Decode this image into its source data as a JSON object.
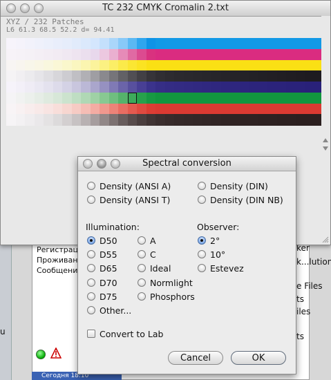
{
  "background_window": {
    "lines": [
      "Регистрац",
      "Проживань",
      "Сообщени"
    ],
    "right_lines": [
      "ker",
      "k...lution",
      "e Files",
      "ts",
      "iles",
      "ts"
    ],
    "left_fragment": "u",
    "bottom_bar": "Сегодня  18:10"
  },
  "chart_window": {
    "title": "TC 232 CMYK Cromalin 2.txt",
    "info_line": "XYZ / 232 Patches",
    "readout": "L6    61.3  68.5  52.2 d= 94.41",
    "grid": {
      "rows": [
        [
          "#f7f4fb",
          "#f5f3fb",
          "#f2f2fb",
          "#eff1fb",
          "#ecf0fb",
          "#e9eefb",
          "#e6edfb",
          "#e1ebfb",
          "#dbe9fc",
          "#d4e6fd",
          "#c4e0fc",
          "#aad6fa",
          "#88c9f8",
          "#5bb8f3",
          "#2fa5ee",
          "#0f93e6",
          "#1199e6",
          "#1299e6",
          "#1299e6",
          "#1299e6",
          "#1299e6",
          "#1299e6",
          "#1299e6",
          "#1299e6",
          "#1299e6",
          "#1299e6",
          "#1299e6",
          "#1299e6",
          "#1299e6",
          "#1299e6",
          "#1299e6",
          "#1299e6",
          "#1299e6",
          "#1299e6"
        ],
        [
          "#f7f3f8",
          "#f6f2f7",
          "#f5f1f6",
          "#f4eff5",
          "#f3edf4",
          "#f2ebf3",
          "#f0e8f2",
          "#eee4f0",
          "#ebdfee",
          "#e8d8ec",
          "#ecc8e0",
          "#eab0d0",
          "#e68bb8",
          "#e06aa3",
          "#dc4b90",
          "#d9327f",
          "#da2c80",
          "#da2c80",
          "#da2c80",
          "#da2c80",
          "#da2c80",
          "#da2c80",
          "#da2c80",
          "#da2c80",
          "#da2c80",
          "#da2c80",
          "#da2c80",
          "#da2c80",
          "#da2c80",
          "#da2c80",
          "#da2c80",
          "#da2c80",
          "#da2c80",
          "#da2c80"
        ],
        [
          "#f8f5f3",
          "#f8f5ef",
          "#f8f6ea",
          "#f9f6e5",
          "#f9f7de",
          "#faf7d6",
          "#faf7cc",
          "#faf6c0",
          "#fbf5b0",
          "#fbf39c",
          "#fbf182",
          "#fbee66",
          "#fbea4a",
          "#fbe633",
          "#fbe322",
          "#fae014",
          "#fae014",
          "#fae014",
          "#fae014",
          "#fae014",
          "#fae014",
          "#fae014",
          "#fae014",
          "#fae014",
          "#fae014",
          "#fae014",
          "#fae014",
          "#fae014",
          "#fae014",
          "#fae014",
          "#fae014",
          "#fae014",
          "#fae014",
          "#fae014"
        ],
        [
          "#f5f3f5",
          "#f1eff2",
          "#ecebee",
          "#e6e5e9",
          "#dfdee2",
          "#d7d6da",
          "#cdccd1",
          "#c0bfc4",
          "#b1b0b5",
          "#9f9ea3",
          "#8a898e",
          "#76757a",
          "#626166",
          "#514f54",
          "#424045",
          "#363439",
          "#302e33",
          "#2d2b30",
          "#2b292e",
          "#2a282d",
          "#29272c",
          "#28262b",
          "#27252a",
          "#262429",
          "#252328",
          "#242227",
          "#232126",
          "#222025",
          "#221f24",
          "#211e23",
          "#201d22",
          "#1f1c21",
          "#1e1b20",
          "#1e1b20"
        ],
        [
          "#f6f3fa",
          "#f3f0f8",
          "#efecf5",
          "#eae8f2",
          "#e4e2ee",
          "#dddbea",
          "#d4d2e5",
          "#c9c6de",
          "#bbb8d6",
          "#aaa6cc",
          "#9691c1",
          "#807ab5",
          "#6b64a9",
          "#58509e",
          "#483f95",
          "#3b338c",
          "#362e86",
          "#342c84",
          "#332b83",
          "#322a82",
          "#312981",
          "#302880",
          "#2f277f",
          "#2e267e",
          "#2e267e",
          "#2d257d",
          "#2c247c",
          "#2c247c",
          "#2b237b",
          "#2b237b",
          "#2a227a",
          "#2a227a",
          "#292179",
          "#292179"
        ],
        [
          "#f5f4f6",
          "#f1f2f1",
          "#ecf0ec",
          "#e6ede6",
          "#dfeadf",
          "#d7e7d8",
          "#cce3ce",
          "#bfdec3",
          "#b0d8b5",
          "#9fd1a5",
          "#88c892",
          "#6fbe7f",
          "#55b36b",
          "#3daa5b",
          "#27a14c",
          "#179943",
          "#12963f",
          "#12963f",
          "#12963f",
          "#12963f",
          "#12963f",
          "#12963f",
          "#12963f",
          "#12963f",
          "#12963f",
          "#12963f",
          "#12963f",
          "#12963f",
          "#12963f",
          "#12963f",
          "#12963f",
          "#12963f",
          "#12963f",
          "#12963f"
        ],
        [
          "#f8f4f6",
          "#f8f1f2",
          "#f8eded",
          "#f8e9e8",
          "#f8e4e2",
          "#f8deda",
          "#f7d6d0",
          "#f6cbc4",
          "#f5bdb5",
          "#f3aca3",
          "#f0988e",
          "#ec8378",
          "#e86d62",
          "#e45a4f",
          "#e04a40",
          "#dd3d34",
          "#db3a32",
          "#db3a32",
          "#db3a32",
          "#db3a32",
          "#db3a32",
          "#db3a32",
          "#db3a32",
          "#db3a32",
          "#db3a32",
          "#db3a32",
          "#db3a32",
          "#db3a32",
          "#db3a32",
          "#db3a32",
          "#db3a32",
          "#db3a32",
          "#db3a32",
          "#db3a32"
        ],
        [
          "#f6f4f6",
          "#f3f1f3",
          "#efedef",
          "#eae8ea",
          "#e4e2e3",
          "#dcdadb",
          "#d3cfd0",
          "#c7c2c3",
          "#b8b1b2",
          "#a69d9e",
          "#918787",
          "#7c7171",
          "#675c5c",
          "#574b4b",
          "#4a3e3e",
          "#403434",
          "#3a2e2e",
          "#372b2b",
          "#352929",
          "#342828",
          "#332727",
          "#322626",
          "#312525",
          "#302424",
          "#2f2323",
          "#2e2222",
          "#2e2222",
          "#2d2121",
          "#2d2121",
          "#2c2020",
          "#2c2020",
          "#2b1f1f",
          "#2b1f1f",
          "#2b1f1f"
        ]
      ]
    }
  },
  "dialog": {
    "title": "Spectral conversion",
    "density": [
      {
        "label": "Density (ANSI A)",
        "selected": false
      },
      {
        "label": "Density (DIN)",
        "selected": false
      },
      {
        "label": "Density (ANSI T)",
        "selected": false
      },
      {
        "label": "Density (DIN NB)",
        "selected": false
      }
    ],
    "illumination_label": "Illumination:",
    "observer_label": "Observer:",
    "illuminants_col1": [
      {
        "label": "D50",
        "selected": true
      },
      {
        "label": "D55",
        "selected": false
      },
      {
        "label": "D65",
        "selected": false
      },
      {
        "label": "D70",
        "selected": false
      },
      {
        "label": "D75",
        "selected": false
      },
      {
        "label": "Other...",
        "selected": false
      }
    ],
    "illuminants_col2": [
      {
        "label": "A",
        "selected": false
      },
      {
        "label": "C",
        "selected": false
      },
      {
        "label": "Ideal",
        "selected": false
      },
      {
        "label": "Normlight",
        "selected": false
      },
      {
        "label": "Phosphors",
        "selected": false
      }
    ],
    "observers": [
      {
        "label": "2°",
        "selected": true
      },
      {
        "label": "10°",
        "selected": false
      },
      {
        "label": "Estevez",
        "selected": false
      }
    ],
    "convert_to_lab": {
      "label": "Convert to Lab",
      "checked": false
    },
    "cancel_label": "Cancel",
    "ok_label": "OK"
  }
}
